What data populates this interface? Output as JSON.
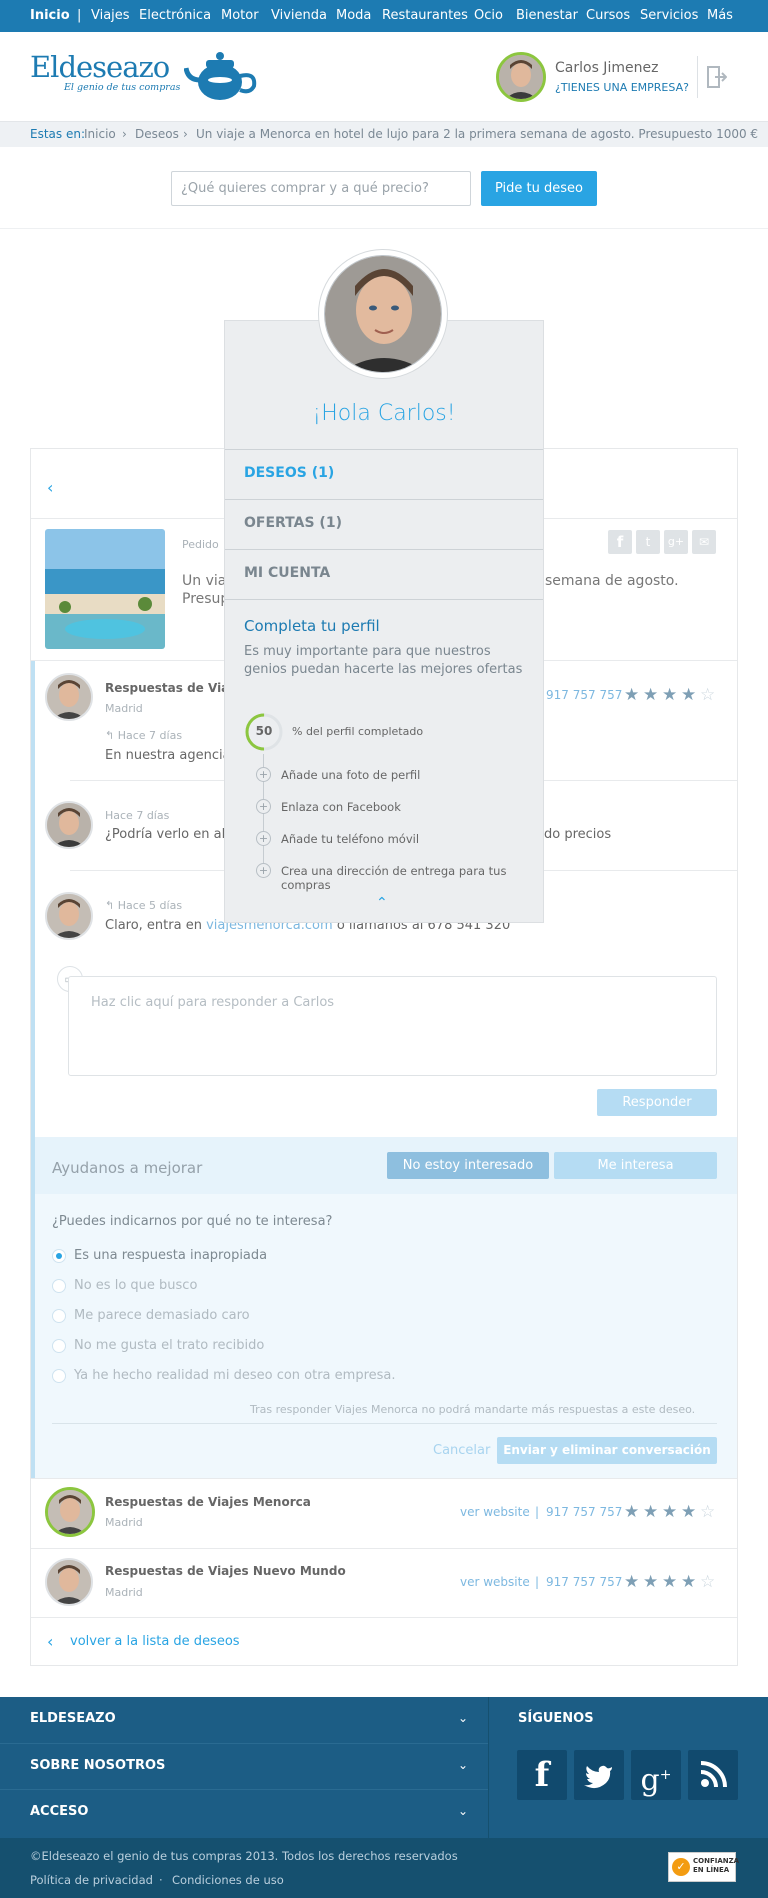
{
  "topnav": {
    "items": [
      "Inicio",
      "|",
      "Viajes",
      "Electrónica",
      "Motor",
      "Vivienda",
      "Moda",
      "Restaurantes",
      "Ocio",
      "Bienestar",
      "Cursos",
      "Servicios",
      "Más"
    ]
  },
  "header": {
    "logo_text": "Eldeseazo",
    "logo_tagline": "El genio de tus compras",
    "user_name": "Carlos Jimenez",
    "company_link": "¿TIENES UNA EMPRESA?"
  },
  "breadcrumb": {
    "prefix": "Estas en:",
    "items": [
      "Inicio",
      "Deseos",
      "Un viaje a Menorca en hotel de lujo para 2 la primera semana de agosto. Presupuesto 1000 €"
    ],
    "sep": "›"
  },
  "search": {
    "placeholder": "¿Qué quieres comprar y a qué precio?",
    "button": "Pide tu deseo"
  },
  "dropdown": {
    "greeting": "¡Hola Carlos!",
    "menu": [
      "DESEOS (1)",
      "OFERTAS (1)",
      "MI CUENTA"
    ],
    "profile_title": "Completa tu perfil",
    "profile_desc": "Es muy importante para que nuestros genios puedan hacerte las mejores ofertas",
    "progress_value": "50",
    "progress_label": "% del perfil completado",
    "progress_fraction": 0.5,
    "tasks": [
      "Añade una foto de perfil",
      "Enlaza con Facebook",
      "Añade tu teléfono móvil",
      "Crea una dirección de entrega para tus compras"
    ]
  },
  "wish": {
    "label": "Pedido",
    "title_left": "Un via",
    "title_right": "semana de agosto.",
    "title_line2": "Presup"
  },
  "thread": {
    "msg1": {
      "title": "Respuestas de Viajes",
      "city": "Madrid",
      "phone": "917 757 757",
      "time": "Hace 7 días",
      "text": "En nuestra agencia d"
    },
    "msg2": {
      "time": "Hace 7 días",
      "text_left": "¿Podría verlo en algu",
      "text_right": "do precios"
    },
    "msg3": {
      "time": "Hace 5 días",
      "text_prefix": "Claro, entra en ",
      "link": "viajesmenorca.com",
      "text_suffix": " o llámanos al 678 541 320"
    },
    "reply_placeholder": "Haz clic aquí para responder a Carlos",
    "reply_button": "Responder"
  },
  "feedback": {
    "title": "Ayudanos a mejorar",
    "not_interested": "No estoy interesado",
    "interested": "Me interesa",
    "question": "¿Puedes indicarnos por qué no te interesa?",
    "options": [
      "Es una respuesta inapropiada",
      "No es lo que busco",
      "Me parece demasiado caro",
      "No me gusta el trato recibido",
      "Ya he hecho realidad mi deseo con otra empresa."
    ],
    "selected_index": 0,
    "note": "Tras responder Viajes Menorca no podrá mandarte más respuestas a este deseo.",
    "cancel": "Cancelar",
    "submit": "Enviar y eliminar conversación"
  },
  "responses": [
    {
      "title": "Respuestas de Viajes Menorca",
      "city": "Madrid",
      "website": "ver website",
      "sep": "|",
      "phone": "917 757 757",
      "rating": 4
    },
    {
      "title": "Respuestas de Viajes Nuevo Mundo",
      "city": "Madrid",
      "website": "ver website",
      "sep": "|",
      "phone": "917 757 757",
      "rating": 4
    }
  ],
  "back_link": "volver a la lista de deseos",
  "footer": {
    "sections": [
      "ELDESEAZO",
      "SOBRE NOSOTROS",
      "ACCESO"
    ],
    "follow_title": "SÍGUENOS",
    "copyright": "©Eldeseazo el genio de tus compras 2013. Todos los derechos reservados",
    "links": [
      "Política de privacidad",
      "·",
      "Condiciones de uso"
    ],
    "badge": "CONFIANZA EN LÍNEA"
  },
  "colors": {
    "brand": "#1d7bb2",
    "accent": "#29a4e3",
    "star": "#7e9fb5",
    "progress": "#8cc63f"
  }
}
